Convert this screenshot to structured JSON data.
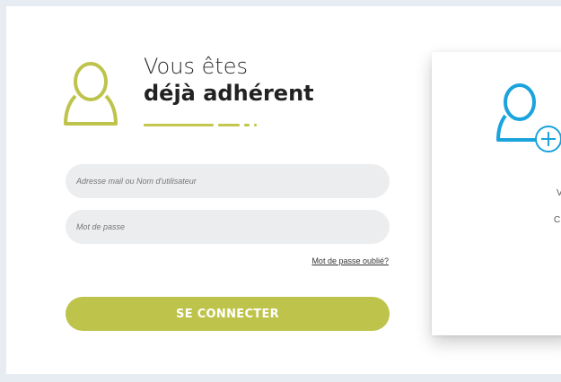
{
  "login": {
    "title_line1": "Vous êtes",
    "title_line2": "déjà adhérent",
    "email_placeholder": "Adresse mail ou Nom d'utilisateur",
    "password_placeholder": "Mot de passe",
    "forgot_password": "Mot de passe oublié?",
    "submit_label": "SE CONNECTER"
  },
  "signup_card": {
    "text_line1": "V",
    "text_line2": "C"
  },
  "colors": {
    "accent_green": "#bec34b",
    "accent_blue": "#1aa3dd",
    "background": "#e6ecf1"
  },
  "icons": {
    "member": "user-icon",
    "new_member": "user-plus-icon"
  }
}
